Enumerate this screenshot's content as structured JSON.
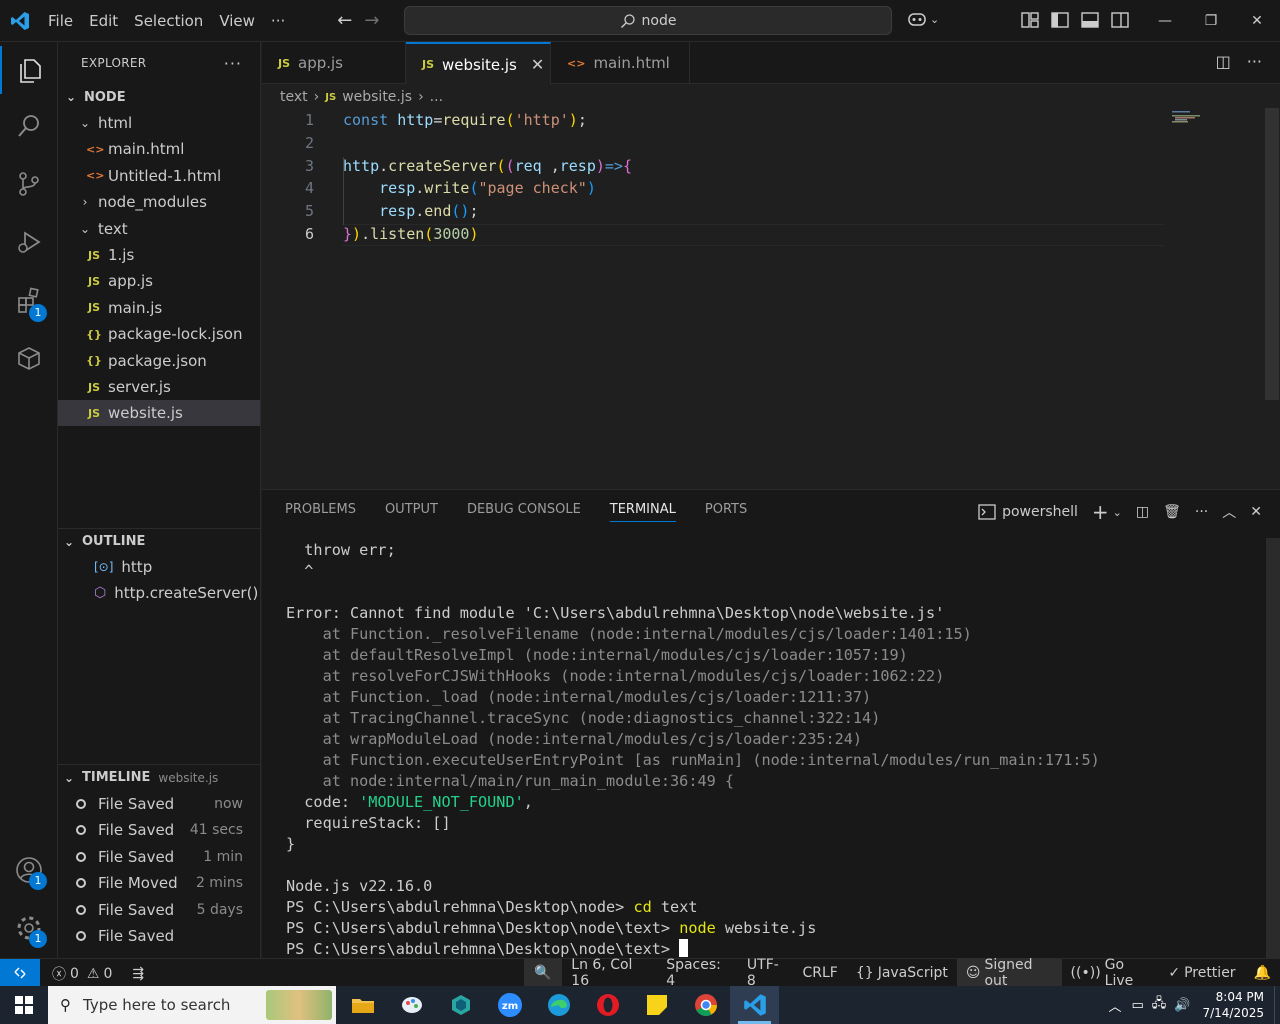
{
  "titlebar": {
    "menu": [
      "File",
      "Edit",
      "Selection",
      "View",
      "···"
    ],
    "search": "node"
  },
  "activity": {
    "extensions_badge": "1",
    "accounts_badge": "1",
    "manage_badge": "1"
  },
  "explorer": {
    "title": "EXPLORER",
    "root": "NODE",
    "tree": [
      {
        "label": "html",
        "kind": "folder-open",
        "depth": 1
      },
      {
        "label": "main.html",
        "kind": "html",
        "depth": 2
      },
      {
        "label": "Untitled-1.html",
        "kind": "html",
        "depth": 2
      },
      {
        "label": "node_modules",
        "kind": "folder-closed",
        "depth": 1
      },
      {
        "label": "text",
        "kind": "folder-open",
        "depth": 1
      },
      {
        "label": "1.js",
        "kind": "js",
        "depth": 2
      },
      {
        "label": "app.js",
        "kind": "js",
        "depth": 2
      },
      {
        "label": "main.js",
        "kind": "js",
        "depth": 2
      },
      {
        "label": "package-lock.json",
        "kind": "json",
        "depth": 2
      },
      {
        "label": "package.json",
        "kind": "json",
        "depth": 2
      },
      {
        "label": "server.js",
        "kind": "js",
        "depth": 2
      },
      {
        "label": "website.js",
        "kind": "js",
        "depth": 2,
        "selected": true
      }
    ]
  },
  "outline": {
    "title": "OUTLINE",
    "items": [
      "http",
      "http.createServer() ..."
    ]
  },
  "timeline": {
    "title": "TIMELINE",
    "file": "website.js",
    "items": [
      {
        "label": "File Saved",
        "when": "now"
      },
      {
        "label": "File Saved",
        "when": "41 secs"
      },
      {
        "label": "File Saved",
        "when": "1 min"
      },
      {
        "label": "File Moved",
        "when": "2 mins"
      },
      {
        "label": "File Saved",
        "when": "5 days"
      },
      {
        "label": "File Saved",
        "when": ""
      }
    ]
  },
  "tabs": [
    {
      "label": "app.js",
      "icon": "JS",
      "active": false
    },
    {
      "label": "website.js",
      "icon": "JS",
      "active": true
    },
    {
      "label": "main.html",
      "icon": "<>",
      "active": false
    }
  ],
  "breadcrumb": [
    "text",
    "website.js",
    "..."
  ],
  "editor": {
    "line_numbers": [
      "1",
      "2",
      "3",
      "4",
      "5",
      "6"
    ],
    "current_line": "6"
  },
  "panel": {
    "tabs": [
      "PROBLEMS",
      "OUTPUT",
      "DEBUG CONSOLE",
      "TERMINAL",
      "PORTS"
    ],
    "active_tab": "TERMINAL",
    "shell": "powershell",
    "terminal_lines": [
      "  throw err;",
      "  ^",
      "",
      "Error: Cannot find module 'C:\\Users\\abdulrehmna\\Desktop\\node\\website.js'",
      "    at Function._resolveFilename (node:internal/modules/cjs/loader:1401:15)",
      "    at defaultResolveImpl (node:internal/modules/cjs/loader:1057:19)",
      "    at resolveForCJSWithHooks (node:internal/modules/cjs/loader:1062:22)",
      "    at Function._load (node:internal/modules/cjs/loader:1211:37)",
      "    at TracingChannel.traceSync (node:diagnostics_channel:322:14)",
      "    at wrapModuleLoad (node:internal/modules/cjs/loader:235:24)",
      "    at Function.executeUserEntryPoint [as runMain] (node:internal/modules/run_main:171:5)",
      "    at node:internal/main/run_main_module:36:49 {",
      "  code: 'MODULE_NOT_FOUND',",
      "  requireStack: []",
      "}",
      "",
      "Node.js v22.16.0",
      "PS C:\\Users\\abdulrehmna\\Desktop\\node> cd text",
      "PS C:\\Users\\abdulrehmna\\Desktop\\node\\text> node website.js",
      "PS C:\\Users\\abdulrehmna\\Desktop\\node\\text> "
    ]
  },
  "statusbar": {
    "errors": "0",
    "warnings": "0",
    "position": "Ln 6, Col 16",
    "spaces": "Spaces: 4",
    "encoding": "UTF-8",
    "eol": "CRLF",
    "language": "JavaScript",
    "account": "Signed out",
    "golive": "Go Live",
    "prettier": "Prettier"
  },
  "taskbar": {
    "search_placeholder": "Type here to search",
    "time": "8:04 PM",
    "date": "7/14/2025"
  },
  "colors": {
    "accent": "#0078d4",
    "background": "#1f1f1f",
    "sidebar": "#181818"
  }
}
